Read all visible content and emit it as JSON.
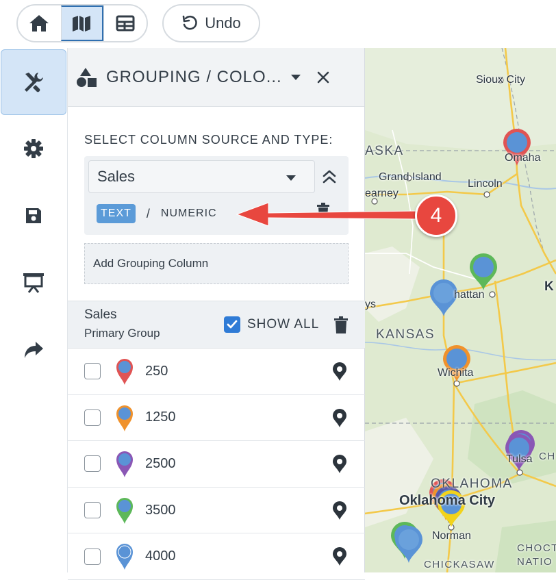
{
  "toolbar": {
    "view_buttons": [
      "home-icon",
      "map-icon",
      "table-icon"
    ],
    "active_view": "map-icon",
    "undo_label": "Undo"
  },
  "rail": {
    "items": [
      "tools-icon",
      "gear-icon",
      "save-icon",
      "presentation-icon",
      "share-icon"
    ],
    "active": "tools-icon"
  },
  "panel": {
    "title": "GROUPING / COLO...",
    "section_label": "SELECT COLUMN SOURCE AND TYPE:",
    "column_select_value": "Sales",
    "type_text": "TEXT",
    "type_separator": "/",
    "type_numeric": "NUMERIC",
    "add_grouping_label": "Add Grouping Column",
    "group_title": "Sales",
    "group_subtitle": "Primary Group",
    "show_all_label": "SHOW ALL",
    "show_all_checked": true,
    "groups": [
      {
        "value": "250",
        "color": "#e05454",
        "checked": false
      },
      {
        "value": "1250",
        "color": "#f0922c",
        "checked": false
      },
      {
        "value": "2500",
        "color": "#8a57b5",
        "checked": false
      },
      {
        "value": "3500",
        "color": "#5db85a",
        "checked": false
      },
      {
        "value": "4000",
        "color": "#5a93d6",
        "checked": false
      }
    ]
  },
  "map": {
    "labels": {
      "sioux_city": "Sioux City",
      "aska": "ASKA",
      "omaha": "Omaha",
      "grand_island": "Grand Island",
      "lincoln": "Lincoln",
      "kearney": "earney",
      "manhattan": "hattan",
      "k": "K",
      "ys": "ys",
      "kansas": "KANSAS",
      "wichita": "Wichita",
      "ch": "CH",
      "tulsa": "Tulsa",
      "oklahoma": "OKLAHOMA",
      "oklahoma_city": "Oklahoma City",
      "norman": "Norman",
      "chickasaw": "CHICKASAW",
      "nation": "NATION",
      "choct": "CHOCT",
      "natio": "NATIO"
    }
  },
  "annotation": {
    "step_number": "4",
    "color": "#e8473f"
  }
}
